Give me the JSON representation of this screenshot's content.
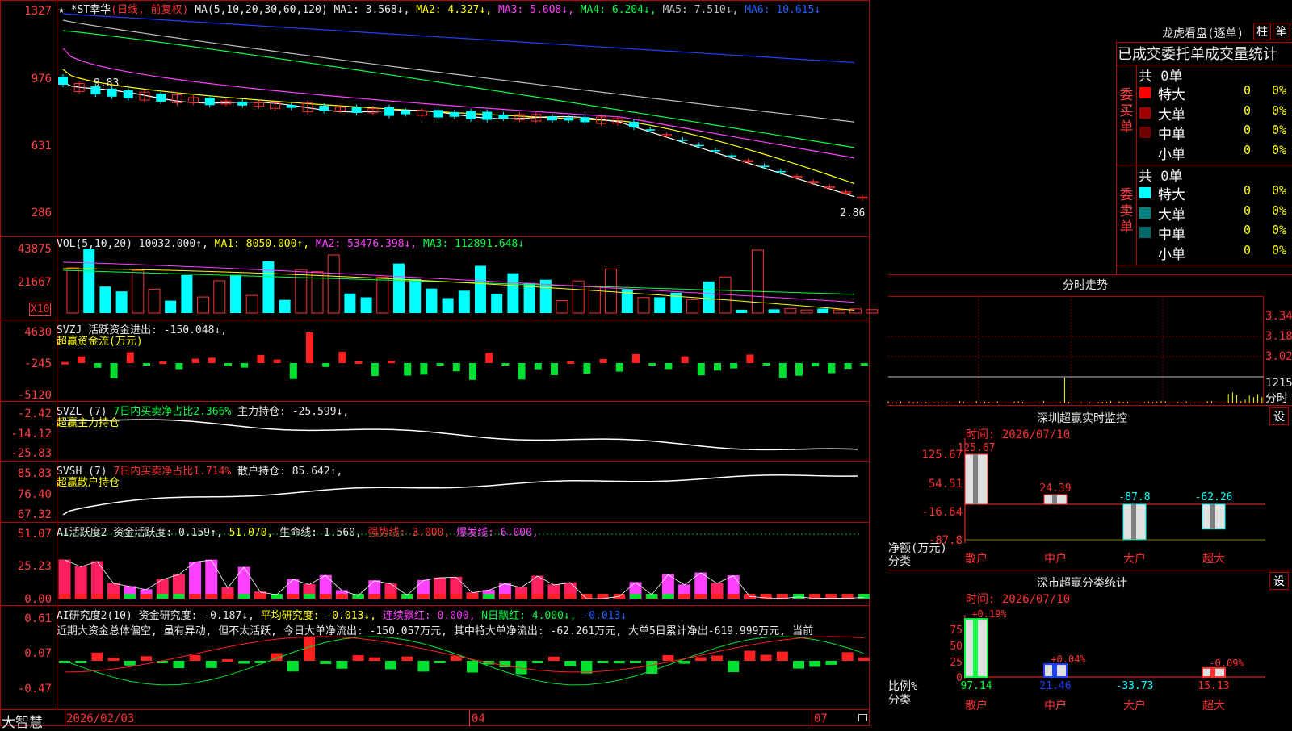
{
  "kline": {
    "title_prefix": "★",
    "stock_name": "*ST幸华",
    "period_label": "(日线, 前复权)",
    "ma_params": "MA(5,10,20,30,60,120)",
    "ma1": "MA1: 3.568↓,",
    "ma2": "MA2: 4.327↓,",
    "ma3": "MA3: 5.608↓,",
    "ma4": "MA4: 6.204↓,",
    "ma5": "MA5: 7.510↓,",
    "ma6": "MA6: 10.615↓",
    "axis": [
      "1327",
      "976",
      "631",
      "286"
    ],
    "high_label": "9.83",
    "low_label": "2.86",
    "colors": {
      "ma1": "#ffffff",
      "ma2": "#ffff00",
      "ma3": "#ff40ff",
      "ma4": "#00ff40",
      "ma5": "#c0c0c0",
      "ma6": "#2040ff"
    }
  },
  "vol": {
    "label": "VOL(5,10,20)",
    "value": "10032.000↑,",
    "ma1": "MA1: 8050.000↑,",
    "ma2": "MA2: 53476.398↓,",
    "ma3": "MA3: 112891.648↓",
    "axis": [
      "43875",
      "21667"
    ],
    "unit": "X10"
  },
  "svzj": {
    "label": "SVZJ",
    "text": "活跃资金进出: -150.048↓,",
    "sub": "超赢资金流(万元)",
    "axis": [
      "4630",
      "-245",
      "-5120"
    ]
  },
  "svzl": {
    "label": "SVZL (7)",
    "text1": "7日内买卖净占比2.366%",
    "text2": "主力持仓: -25.599↓,",
    "sub": "超赢主力持仓",
    "axis": [
      "-2.42",
      "-14.12",
      "-25.83"
    ]
  },
  "svsh": {
    "label": "SVSH (7)",
    "text1": "7日内买卖净占比1.714%",
    "text2": "散户持仓: 85.642↑,",
    "sub": "超赢散户持仓",
    "axis": [
      "85.83",
      "76.40",
      "67.32"
    ]
  },
  "ai1": {
    "label": "AI活跃度2",
    "t1": "资金活跃度: 0.159↑,",
    "t2": "51.070,",
    "t3": "生命线: 1.560,",
    "t4": "强势线: 3.000,",
    "t5": "爆发线: 6.000,",
    "axis": [
      "51.07",
      "25.23",
      "0.00"
    ]
  },
  "ai2": {
    "label": "AI研究度2(10)",
    "t1": "资金研究度: -0.187↓,",
    "t2": "平均研究度: -0.013↓,",
    "t3": "连续飘红: 0.000,",
    "t4": "N日飘红: 4.000↓,",
    "t5": "-0.013↓",
    "commentary": "近期大资金总体偏空, 虽有异动, 但不太活跃, 今日大单净流出: -150.057万元, 其中特大单净流出: -62.261万元, 大单5日累计净出-619.999万元, 当前",
    "axis": [
      "0.61",
      "0.07",
      "-0.47"
    ]
  },
  "bottom": {
    "brand": "大智慧",
    "date1": "2026/02/03",
    "date2": "04",
    "date3": "07"
  },
  "dragon": {
    "title": "龙虎看盘(逐单)",
    "btn1": "柱",
    "btn2": "笔",
    "tabs": "已成交委托单成交量统计",
    "buy_label": "委买单",
    "sell_label": "委卖单",
    "buy_total": "共 0单",
    "sell_total": "共 0单",
    "buy_rows": [
      {
        "name": "特大",
        "val": "0",
        "pct": "0%",
        "color": "#ff0000"
      },
      {
        "name": "大单",
        "val": "0",
        "pct": "0%",
        "color": "#a00000"
      },
      {
        "name": "中单",
        "val": "0",
        "pct": "0%",
        "color": "#700000"
      },
      {
        "name": "小单",
        "val": "0",
        "pct": "0%",
        "color": "#000000"
      }
    ],
    "sell_rows": [
      {
        "name": "特大",
        "val": "0",
        "pct": "0%",
        "color": "#00ffff"
      },
      {
        "name": "大单",
        "val": "0",
        "pct": "0%",
        "color": "#008080"
      },
      {
        "name": "中单",
        "val": "0",
        "pct": "0%",
        "color": "#006868"
      },
      {
        "name": "小单",
        "val": "0",
        "pct": "0%",
        "color": "#000000"
      }
    ]
  },
  "intraday": {
    "title": "分时走势",
    "prices": [
      "3.340",
      "3.180",
      "3.020"
    ],
    "vol_label": "1215",
    "vol_unit": "分时"
  },
  "monitor": {
    "title": "深圳超赢实时监控",
    "btn": "设",
    "time": "时间: 2026/07/10",
    "axis": [
      "125.67",
      "54.51",
      "-16.64",
      "-87.8"
    ],
    "net_label": "净额(万元)",
    "cat_label": "分类",
    "categories": [
      "散户",
      "中户",
      "大户",
      "超大"
    ],
    "values": [
      125.67,
      24.39,
      -87.8,
      -62.26
    ],
    "value_labels": [
      "125.67",
      "24.39",
      "-87.8",
      "-62.26"
    ]
  },
  "classify": {
    "title": "深市超赢分类统计",
    "btn": "设",
    "time": "时间: 2026/07/10",
    "axis": [
      "75",
      "50",
      "25",
      "0"
    ],
    "ratio_label": "比例%",
    "cat_label": "分类",
    "categories": [
      "散户",
      "中户",
      "大户",
      "超大"
    ],
    "top_labels": [
      "+0.19%",
      "+0.04%",
      "",
      "-0.09%"
    ],
    "values": [
      97.14,
      21.46,
      -33.73,
      15.13
    ],
    "value_labels": [
      "97.14",
      "21.46",
      "-33.73",
      "15.13"
    ]
  }
}
